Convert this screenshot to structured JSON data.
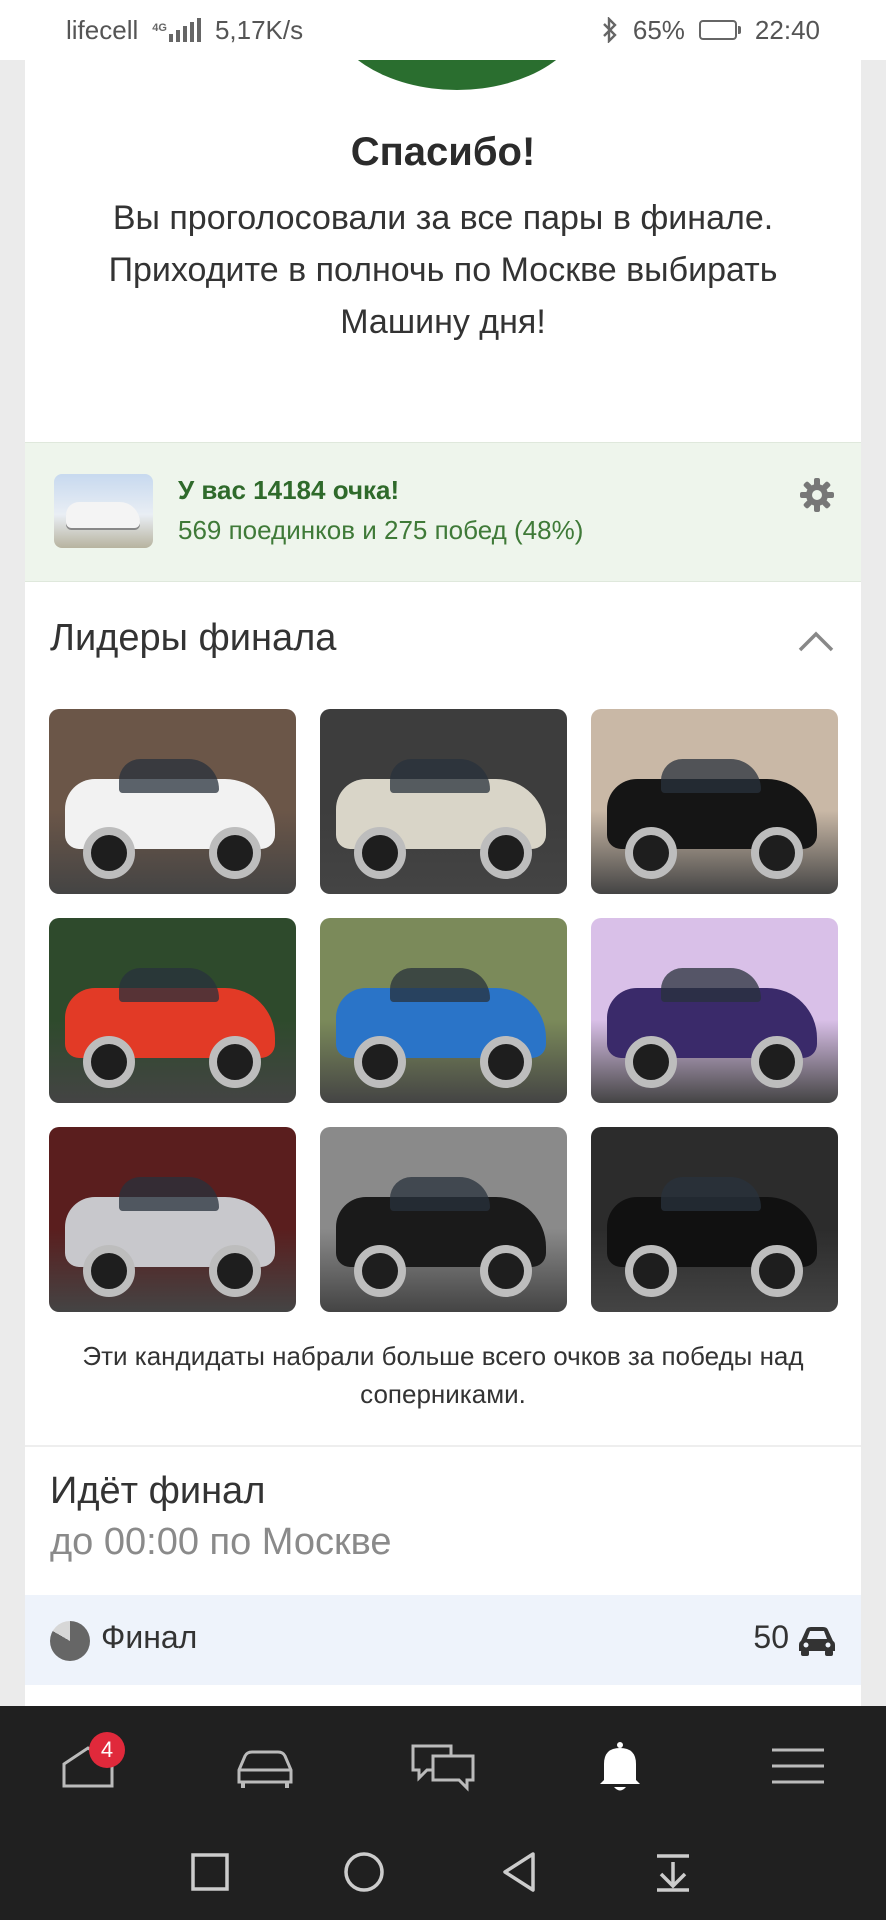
{
  "status_bar": {
    "carrier": "lifecell",
    "network_tag": "4G",
    "speed": "5,17K/s",
    "battery": "65%",
    "battery_level": 0.65,
    "time": "22:40",
    "icons": [
      "signal-icon",
      "bluetooth-icon",
      "battery-icon"
    ]
  },
  "thanks": {
    "title": "Спасибо!",
    "text": "Вы проголосовали за все пары в финале. Приходите в полночь по Москве выбирать Машину дня!"
  },
  "score": {
    "title": "У вас 14184 очка!",
    "subtitle": "569 поединков и 275 побед (48%)",
    "settings_icon": "gear-icon"
  },
  "leaders": {
    "title": "Лидеры финала",
    "toggle_icon": "chevron-up-icon",
    "tiles": [
      {
        "name": "white-tuned-sedan",
        "bg": "#6b5648",
        "body": "#f2f2f2"
      },
      {
        "name": "beige-vintage-car",
        "bg": "#3d3d3d",
        "body": "#d9d5c8"
      },
      {
        "name": "black-hatchback",
        "bg": "#c9b8a6",
        "body": "#151515"
      },
      {
        "name": "red-coupe",
        "bg": "#2e4a2c",
        "body": "#e23a26"
      },
      {
        "name": "blue-white-classic",
        "bg": "#7b8a5a",
        "body": "#2a74c8"
      },
      {
        "name": "purple-lit-car",
        "bg": "#d9c0e8",
        "body": "#3a2a6a"
      },
      {
        "name": "silver-sedan-forest",
        "bg": "#5a1e1e",
        "body": "#c8c8cc"
      },
      {
        "name": "black-sports-car",
        "bg": "#8a8a8a",
        "body": "#1a1a1a"
      },
      {
        "name": "black-pickup-truck",
        "bg": "#2c2c2c",
        "body": "#111111"
      }
    ],
    "note": "Эти кандидаты набрали больше всего очков за победы над соперниками."
  },
  "final": {
    "title": "Идёт финал",
    "subtitle": "до 00:00 по Москве",
    "row_label": "Финал",
    "count": "50",
    "progress_icon": "pie-progress-icon",
    "car_icon": "car-icon"
  },
  "bottom_nav": {
    "items": [
      "home-icon",
      "garage-car-icon",
      "messages-icon",
      "notifications-bell-icon",
      "menu-icon"
    ],
    "badge": "4"
  },
  "system_nav": {
    "items": [
      "recent-apps-icon",
      "home-circle-icon",
      "back-icon",
      "notification-shade-icon"
    ]
  }
}
